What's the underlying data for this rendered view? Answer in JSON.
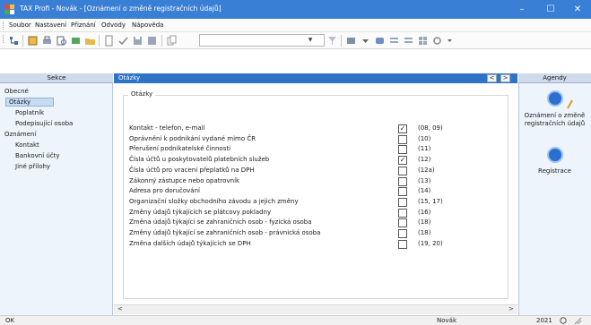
{
  "window": {
    "title": "TAX Profi - Novák - [Oznámení o změně registračních údajů]",
    "min_glyph": "–",
    "max_glyph": "☐",
    "close_glyph": "✕"
  },
  "menu": {
    "items": [
      "Soubor",
      "Nastavení",
      "Přiznání",
      "Odvody",
      "Nápověda"
    ]
  },
  "left_panel": {
    "header": "Sekce",
    "tree": [
      "Obecné",
      "Otázky",
      "Poplatník",
      "Podepisující osoba",
      "Oznámení",
      "Kontakt",
      "Bankovní účty",
      "Jiné přílohy"
    ],
    "selected": "Otázky"
  },
  "main": {
    "header": "Otázky",
    "nav_prev": "<",
    "nav_next": ">",
    "group_label": "Otázky",
    "rows": [
      {
        "label": "Kontakt - telefon, e-mail",
        "checked": true,
        "code": "(08, 09)"
      },
      {
        "label": "Oprávnění k podnikání vydané mimo ČR",
        "checked": false,
        "code": "(10)"
      },
      {
        "label": "Přerušení podnikatelské činnosti",
        "checked": false,
        "code": "(11)"
      },
      {
        "label": "Čísla účtů u poskytovatelů platebních služeb",
        "checked": true,
        "code": "(12)"
      },
      {
        "label": "Čísla účtů pro vracení přeplatků na DPH",
        "checked": false,
        "code": "(12a)"
      },
      {
        "label": "Zákonný zástupce nebo opatrovník",
        "checked": false,
        "code": "(13)"
      },
      {
        "label": "Adresa pro doručování",
        "checked": false,
        "code": "(14)"
      },
      {
        "label": "Organizační složky obchodního závodu a jejich změny",
        "checked": false,
        "code": "(15, 17)"
      },
      {
        "label": "Změny údajů týkajících se plátcovy pokladny",
        "checked": false,
        "code": "(16)"
      },
      {
        "label": "Změna údajů týkající se zahraničních osob - fyzická osoba",
        "checked": false,
        "code": "(18)"
      },
      {
        "label": "Změny údajů týkající se zahraničních osob - právnická osoba",
        "checked": false,
        "code": "(18)"
      },
      {
        "label": "Změna dalších údajů týkajících se DPH",
        "checked": false,
        "code": "(19, 20)"
      }
    ],
    "scroll_left": "<",
    "scroll_right": ">"
  },
  "right_panel": {
    "header": "Agendy",
    "items": [
      {
        "label_line1": "Oznámení o změně",
        "label_line2": "registračních údajů"
      },
      {
        "label_line1": "Registrace",
        "label_line2": ""
      }
    ]
  },
  "status": {
    "left": "OK",
    "user": "Novák",
    "year": "2021"
  },
  "colors": {
    "titlebar": "#3a7fd6",
    "main_header": "#2f73c9",
    "panel_bg": "#eef4fb"
  }
}
